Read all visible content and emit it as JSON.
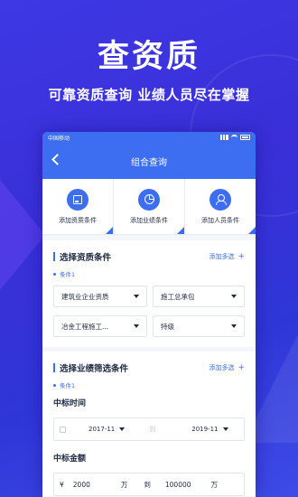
{
  "promo": {
    "headline": "查资质",
    "subline": "可靠资质查询 业绩人员尽在掌握"
  },
  "statusbar": {
    "carrier": "中国移动"
  },
  "navbar": {
    "title": "组合查询"
  },
  "cards": [
    {
      "label": "添加资质条件",
      "icon": "certificate-icon"
    },
    {
      "label": "添加业绩条件",
      "icon": "pie-chart-icon"
    },
    {
      "label": "添加人员条件",
      "icon": "person-icon"
    }
  ],
  "qualification": {
    "title": "选择资质条件",
    "add_more": "添加多选",
    "condition_label": "条件1",
    "selects": [
      "建筑业企业资质",
      "施工总承包",
      "冶金工程施工...",
      "特级"
    ]
  },
  "performance": {
    "title": "选择业绩筛选条件",
    "add_more": "添加多选",
    "condition_label": "条件1",
    "bid_time": {
      "label": "中标时间",
      "from": "2017-11",
      "separator": "到",
      "to": "2019-11"
    },
    "bid_amount": {
      "label": "中标金额",
      "currency": "¥",
      "min": "2000",
      "unit1": "万",
      "separator": "到",
      "max": "100000",
      "unit2": "万"
    }
  },
  "colors": {
    "accent": "#3d6df0",
    "background": "#3a2fd8"
  }
}
